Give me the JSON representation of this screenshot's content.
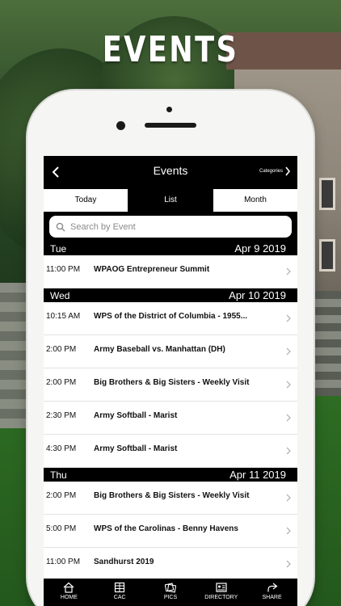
{
  "promo": {
    "title": "EVENTS"
  },
  "navbar": {
    "title": "Events",
    "categories_label": "Categories"
  },
  "segments": [
    {
      "label": "Today",
      "active": false
    },
    {
      "label": "List",
      "active": true
    },
    {
      "label": "Month",
      "active": false
    }
  ],
  "search": {
    "placeholder": "Search by Event"
  },
  "days": [
    {
      "day": "Tue",
      "date": "Apr 9 2019",
      "events": [
        {
          "time": "11:00 PM",
          "name": "WPAOG Entrepreneur Summit"
        }
      ]
    },
    {
      "day": "Wed",
      "date": "Apr 10 2019",
      "events": [
        {
          "time": "10:15 AM",
          "name": "WPS of the District of Columbia - 1955..."
        },
        {
          "time": "2:00 PM",
          "name": "Army Baseball vs. Manhattan (DH)"
        },
        {
          "time": "2:00 PM",
          "name": "Big Brothers & Big Sisters - Weekly Visit"
        },
        {
          "time": "2:30 PM",
          "name": "Army Softball  - Marist"
        },
        {
          "time": "4:30 PM",
          "name": "Army Softball  - Marist"
        }
      ]
    },
    {
      "day": "Thu",
      "date": "Apr 11 2019",
      "events": [
        {
          "time": "2:00 PM",
          "name": "Big Brothers & Big Sisters - Weekly Visit"
        },
        {
          "time": "5:00 PM",
          "name": "WPS of the Carolinas - Benny Havens"
        },
        {
          "time": "11:00 PM",
          "name": "Sandhurst 2019"
        }
      ]
    }
  ],
  "tabbar": [
    {
      "label": "HOME",
      "icon": "home-icon"
    },
    {
      "label": "CAC",
      "icon": "building-icon"
    },
    {
      "label": "PICS",
      "icon": "photos-icon"
    },
    {
      "label": "DIRECTORY",
      "icon": "contact-card-icon"
    },
    {
      "label": "SHARE",
      "icon": "share-icon"
    }
  ]
}
